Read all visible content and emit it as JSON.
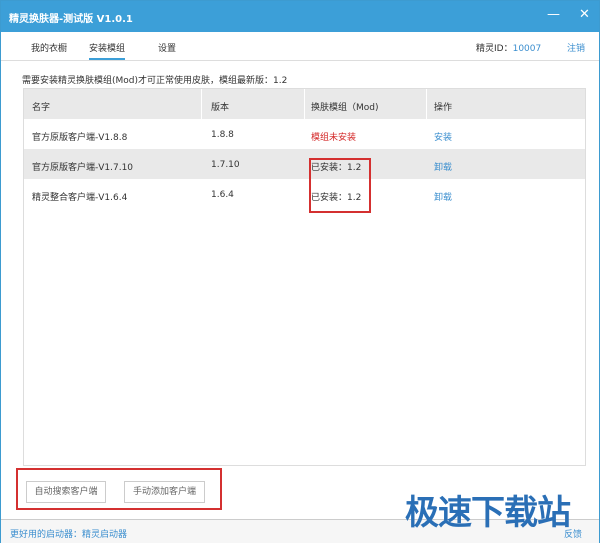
{
  "window": {
    "title": "精灵换肤器-测试版 V1.0.1",
    "minimize": "—",
    "close": "✕"
  },
  "tabs": [
    {
      "label": "我的衣橱"
    },
    {
      "label": "安装模组",
      "active": true
    },
    {
      "label": "设置"
    }
  ],
  "user": {
    "id_label": "精灵ID：",
    "id_value": "10007",
    "logout": "注销"
  },
  "notice": "需要安装精灵换肤模组(Mod)才可正常使用皮肤，模组最新版：1.2",
  "table": {
    "headers": [
      "名字",
      "版本",
      "换肤模组（Mod)",
      "操作"
    ],
    "rows": [
      {
        "name": "官方原版客户端-V1.8.8",
        "version": "1.8.8",
        "mod": "模组未安装",
        "action": "安装",
        "installed": false
      },
      {
        "name": "官方原版客户端-V1.7.10",
        "version": "1.7.10",
        "mod": "已安装：1.2",
        "action": "卸载",
        "installed": true
      },
      {
        "name": "精灵整合客户端-V1.6.4",
        "version": "1.6.4",
        "mod": "已安装：1.2",
        "action": "卸载",
        "installed": true
      }
    ]
  },
  "buttons": {
    "auto_search": "自动搜索客户端",
    "manual_add": "手动添加客户端"
  },
  "footer": {
    "launcher": "更好用的启动器：精灵启动器",
    "feedback": "反馈"
  },
  "watermark": "极速下载站",
  "colors": {
    "accent": "#3c9fd8",
    "highlight": "#d43030"
  }
}
